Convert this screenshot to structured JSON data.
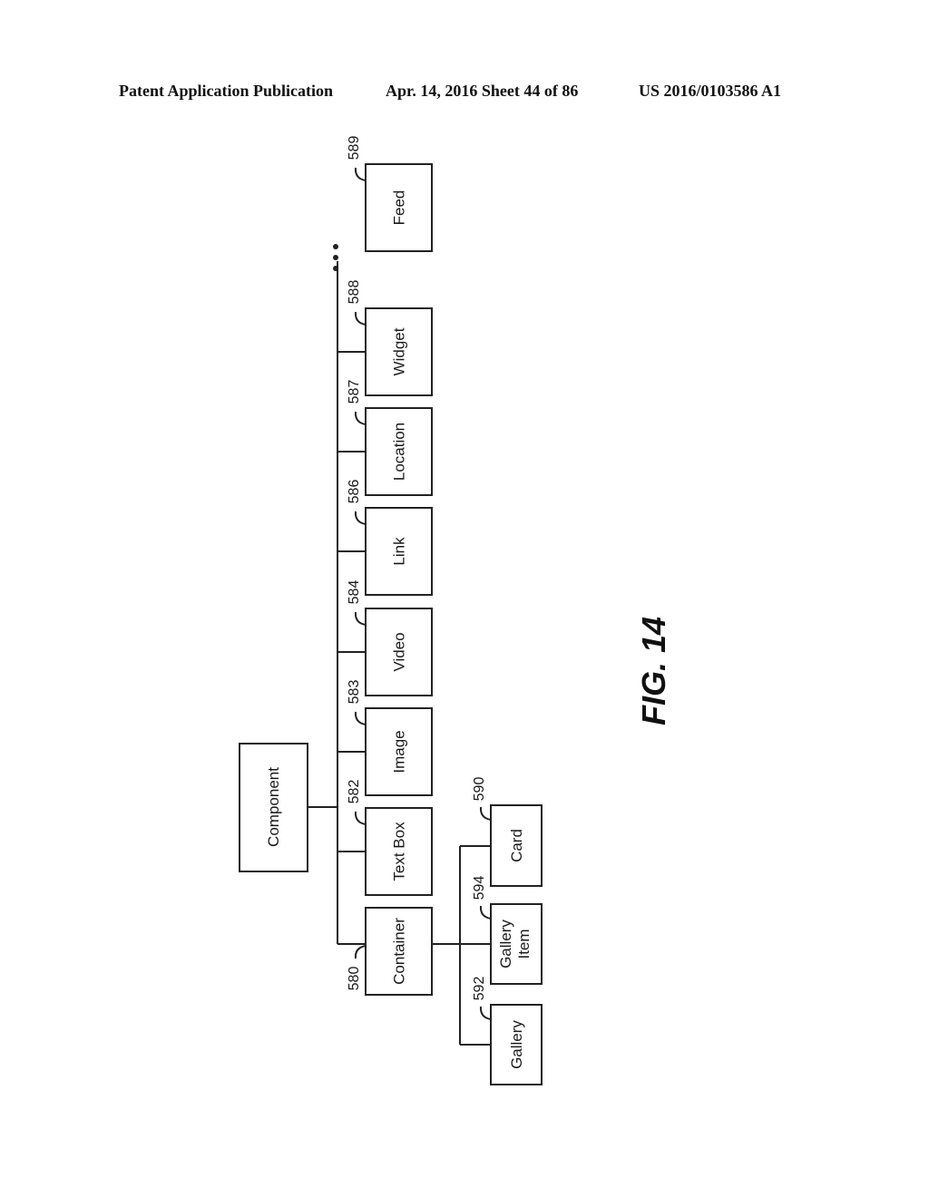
{
  "header": {
    "publication": "Patent Application Publication",
    "date_sheet": "Apr. 14, 2016  Sheet 44 of 86",
    "patent_number": "US 2016/0103586 A1"
  },
  "figure_label": "FIG. 14",
  "diagram": {
    "root": {
      "label": "Component"
    },
    "children": [
      {
        "label": "Container",
        "ref": "580"
      },
      {
        "label": "Text Box",
        "ref": "582"
      },
      {
        "label": "Image",
        "ref": "583"
      },
      {
        "label": "Video",
        "ref": "584"
      },
      {
        "label": "Link",
        "ref": "586"
      },
      {
        "label": "Location",
        "ref": "587"
      },
      {
        "label": "Widget",
        "ref": "588"
      },
      {
        "label": "Feed",
        "ref": "589"
      }
    ],
    "ellipsis": "more component types (…)",
    "container_children": [
      {
        "label": "Gallery",
        "ref": "592"
      },
      {
        "label": "Gallery Item",
        "ref": "594",
        "lines": [
          "Gallery",
          "Item"
        ]
      },
      {
        "label": "Card",
        "ref": "590"
      }
    ]
  }
}
